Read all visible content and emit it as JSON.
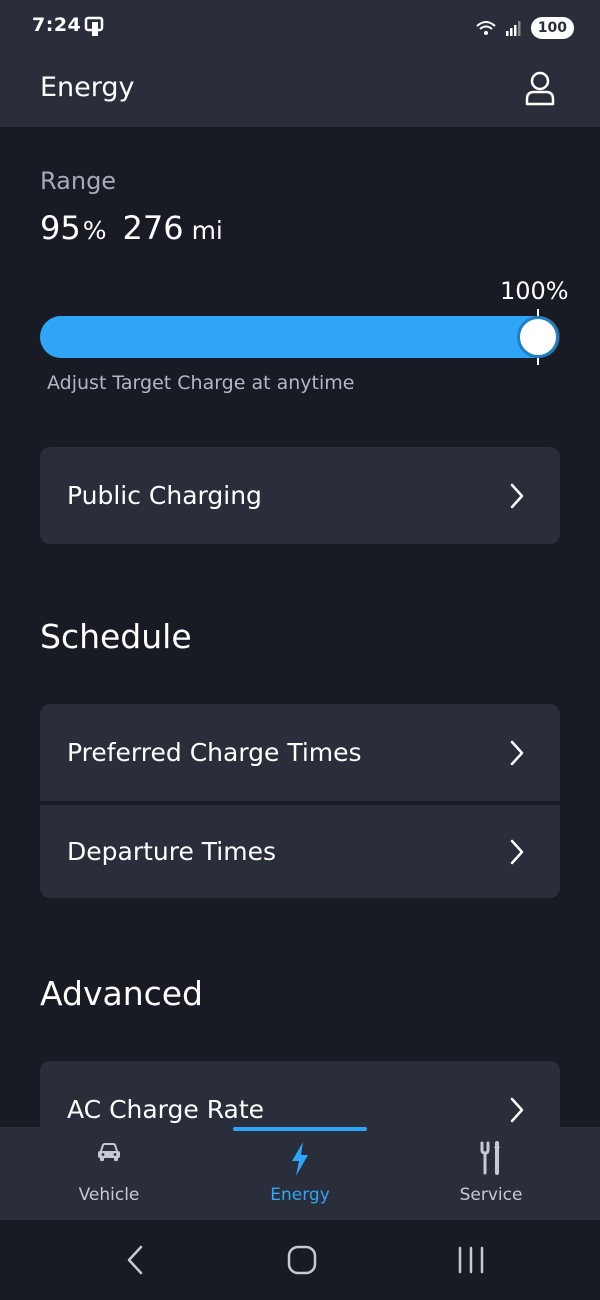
{
  "status_bar": {
    "time": "7:24",
    "battery": "100",
    "icons": [
      "notification-icon",
      "wifi-icon",
      "signal-icon"
    ]
  },
  "header": {
    "title": "Energy",
    "profile_icon": "person-icon"
  },
  "range": {
    "label": "Range",
    "percent": "95",
    "percent_unit": "%",
    "miles": "276",
    "miles_unit": "mi"
  },
  "target_charge": {
    "value_label": "100%",
    "level": 0.95,
    "hint": "Adjust Target Charge at anytime"
  },
  "public_charging": {
    "label": "Public Charging"
  },
  "schedule": {
    "title": "Schedule",
    "items": [
      {
        "label": "Preferred Charge Times"
      },
      {
        "label": "Departure Times"
      }
    ]
  },
  "advanced": {
    "title": "Advanced",
    "items": [
      {
        "label": "AC Charge Rate"
      }
    ]
  },
  "bottom_nav": {
    "items": [
      {
        "label": "Vehicle",
        "icon": "car-icon"
      },
      {
        "label": "Energy",
        "icon": "bolt-icon",
        "active": true
      },
      {
        "label": "Service",
        "icon": "tools-icon"
      }
    ]
  },
  "colors": {
    "accent": "#2fa5f8",
    "background": "#181b24",
    "surface": "#2a2d3a"
  }
}
